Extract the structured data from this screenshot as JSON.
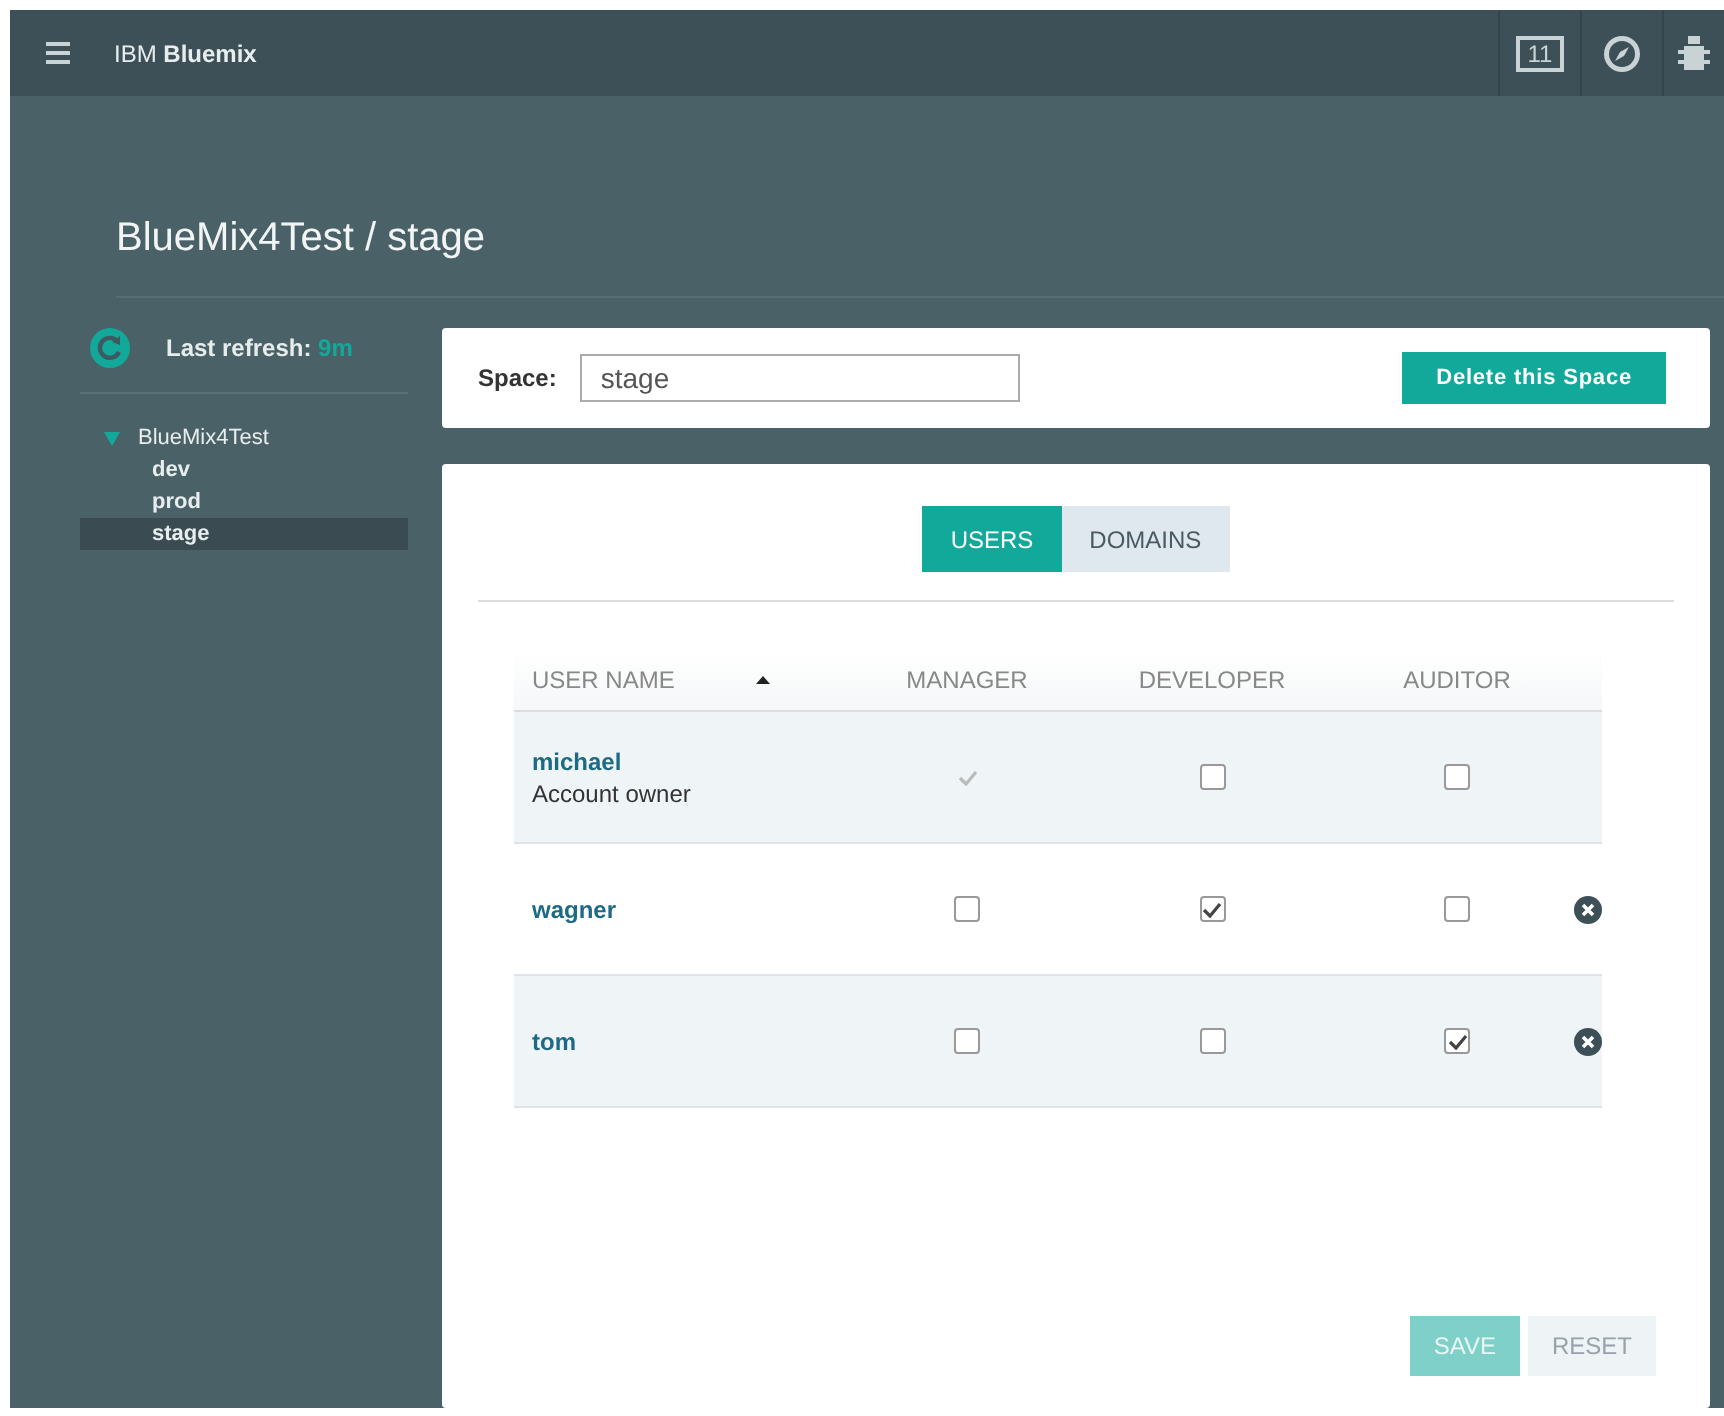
{
  "header": {
    "brand_prefix": "IBM",
    "brand_name": "Bluemix",
    "calendar_day": "11"
  },
  "page_title": "BlueMix4Test / stage",
  "sidebar": {
    "refresh_label": "Last refresh:",
    "refresh_age": "9m",
    "tree": [
      {
        "label": "BlueMix4Test",
        "expanded": true,
        "selected": false,
        "children": [
          {
            "label": "dev",
            "selected": false
          },
          {
            "label": "prod",
            "selected": false
          },
          {
            "label": "stage",
            "selected": true
          }
        ]
      }
    ]
  },
  "space": {
    "label": "Space:",
    "value": "stage",
    "delete_button": "Delete this Space"
  },
  "tabs": [
    {
      "label": "USERS",
      "selected": true
    },
    {
      "label": "DOMAINS",
      "selected": false
    }
  ],
  "table": {
    "columns": [
      {
        "label": "USER NAME",
        "sorted": true
      },
      {
        "label": "MANAGER"
      },
      {
        "label": "DEVELOPER"
      },
      {
        "label": "AUDITOR"
      }
    ],
    "rows": [
      {
        "name": "michael",
        "note": "Account owner",
        "removable": false,
        "roles": [
          {
            "checked": true,
            "disabled": true
          },
          {
            "checked": false,
            "disabled": false
          },
          {
            "checked": false,
            "disabled": false
          }
        ]
      },
      {
        "name": "wagner",
        "removable": true,
        "roles": [
          {
            "checked": false,
            "disabled": false
          },
          {
            "checked": true,
            "disabled": false
          },
          {
            "checked": false,
            "disabled": false
          }
        ]
      },
      {
        "name": "tom",
        "removable": true,
        "roles": [
          {
            "checked": false,
            "disabled": false
          },
          {
            "checked": false,
            "disabled": false
          },
          {
            "checked": true,
            "disabled": false
          }
        ]
      }
    ]
  },
  "buttons": [
    {
      "label": "SAVE",
      "kind": "primary",
      "disabled": true
    },
    {
      "label": "RESET",
      "kind": "secondary",
      "disabled": true
    }
  ]
}
